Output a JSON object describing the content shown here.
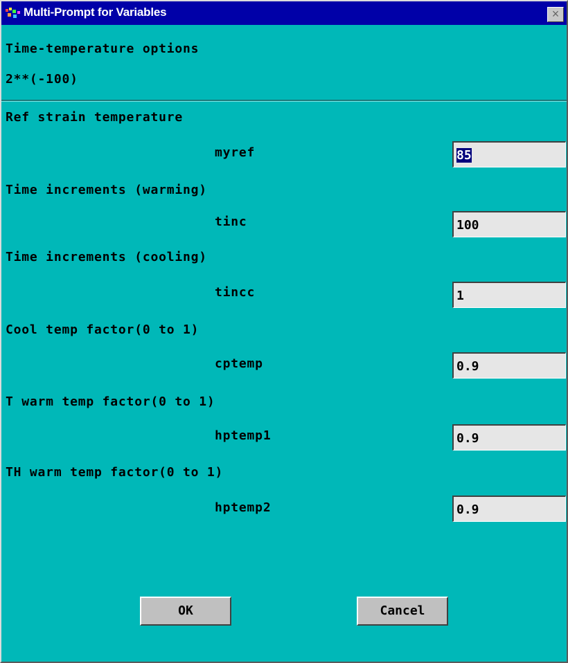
{
  "window": {
    "title": "Multi-Prompt for Variables",
    "close_label": "×"
  },
  "header": {
    "line1": "Time-temperature options",
    "line2": "2**(-100)"
  },
  "fields": [
    {
      "group": "Ref strain temperature",
      "var": "myref",
      "value": "85"
    },
    {
      "group": "Time increments (warming)",
      "var": "tinc",
      "value": "100"
    },
    {
      "group": "Time increments (cooling)",
      "var": "tincc",
      "value": "1"
    },
    {
      "group": "Cool temp factor(0 to 1)",
      "var": "cptemp",
      "value": "0.9"
    },
    {
      "group": "T warm temp factor(0 to 1)",
      "var": "hptemp1",
      "value": "0.9"
    },
    {
      "group": "TH warm temp factor(0 to 1)",
      "var": "hptemp2",
      "value": "0.9"
    }
  ],
  "buttons": {
    "ok": "OK",
    "cancel": "Cancel"
  },
  "colors": {
    "dialog_bg": "#00b8b8",
    "titlebar_bg": "#0000a8",
    "field_bg": "#e6e6e6",
    "selection": "#00007c"
  }
}
